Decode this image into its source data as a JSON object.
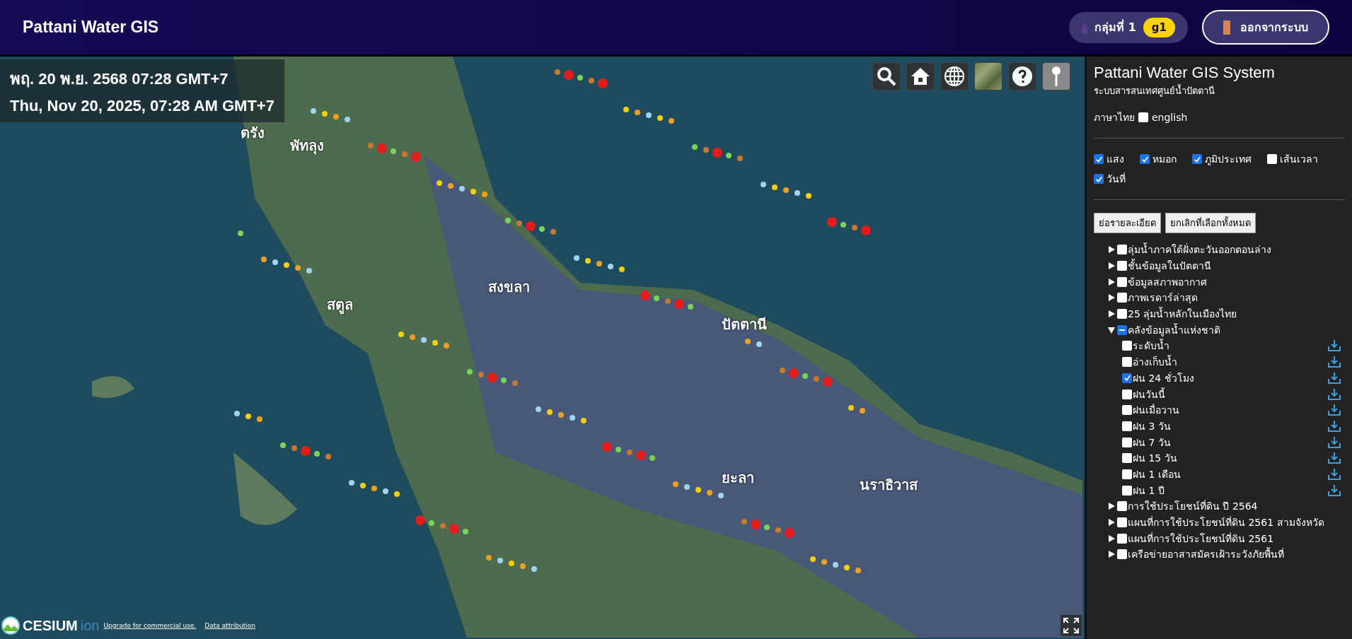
{
  "header": {
    "title": "Pattani Water GIS",
    "group_label": "กลุ่มที่ 1",
    "group_badge": "g1",
    "logout": "ออกจากระบบ"
  },
  "map": {
    "datetime_th": "พฤ. 20 พ.ย. 2568 07:28 GMT+7",
    "datetime_en": "Thu, Nov 20, 2025, 07:28 AM GMT+7",
    "place_labels": [
      {
        "text": "ตรัง"
      },
      {
        "text": "พัทลุง"
      },
      {
        "text": "สงขลา"
      },
      {
        "text": "สตูล"
      },
      {
        "text": "ปัตตานี"
      },
      {
        "text": "ยะลา"
      },
      {
        "text": "นราธิวาส"
      }
    ],
    "attribution": {
      "logo": "CESIUM",
      "logo_suffix": "ion",
      "links": [
        "Upgrade for commercial use.",
        "Data attribution"
      ]
    }
  },
  "sidebar": {
    "title": "Pattani Water GIS System",
    "subtitle": "ระบบสารสนเทศศูนย์น้ำปัตตานี",
    "language": {
      "label": "ภาษาไทย",
      "option": "english",
      "checked": false
    },
    "display_options": [
      {
        "label": "แสง",
        "checked": true
      },
      {
        "label": "หมอก",
        "checked": true
      },
      {
        "label": "ภูมิประเทศ",
        "checked": true
      },
      {
        "label": "เส้นเวลา",
        "checked": false
      },
      {
        "label": "วันที่",
        "checked": true
      }
    ],
    "buttons": [
      "ย่อรายละเอียด",
      "ยกเลิกที่เลือกทั้งหมด"
    ],
    "layers": [
      {
        "label": "ลุ่มน้ำภาคใต้ฝั่งตะวันออกตอนล่าง",
        "checked": false,
        "indeterminate": false,
        "expanded": false
      },
      {
        "label": "ชั้นข้อมูลในปัตตานี",
        "checked": false,
        "indeterminate": false,
        "expanded": false
      },
      {
        "label": "ข้อมูลสภาพอากาศ",
        "checked": false,
        "indeterminate": false,
        "expanded": false
      },
      {
        "label": "ภาพเรดาร์ล่าสุด",
        "checked": false,
        "indeterminate": false,
        "expanded": false
      },
      {
        "label": "25 ลุ่มน้ำหลักในเมืองไทย",
        "checked": false,
        "indeterminate": false,
        "expanded": false
      },
      {
        "label": "คลังข้อมูลน้ำแห่งชาติ",
        "checked": false,
        "indeterminate": true,
        "expanded": true,
        "children": [
          {
            "label": "ระดับน้ำ",
            "checked": false
          },
          {
            "label": "อ่างเก็บน้ำ",
            "checked": false
          },
          {
            "label": "ฝน 24 ชั่วโมง",
            "checked": true
          },
          {
            "label": "ฝนวันนี้",
            "checked": false
          },
          {
            "label": "ฝนเมื่อวาน",
            "checked": false
          },
          {
            "label": "ฝน 3 วัน",
            "checked": false
          },
          {
            "label": "ฝน 7 วัน",
            "checked": false
          },
          {
            "label": "ฝน 15 วัน",
            "checked": false
          },
          {
            "label": "ฝน 1 เดือน",
            "checked": false
          },
          {
            "label": "ฝน 1 ปี",
            "checked": false
          }
        ]
      },
      {
        "label": "การใช้ประโยชน์ที่ดิน ปี 2564",
        "checked": false,
        "indeterminate": false,
        "expanded": false
      },
      {
        "label": "แผนที่การใช้ประโยชน์ที่ดิน 2561 สามจังหวัด",
        "checked": false,
        "indeterminate": false,
        "expanded": false
      },
      {
        "label": "แผนที่การใช้ประโยชน์ที่ดิน 2561",
        "checked": false,
        "indeterminate": false,
        "expanded": false
      },
      {
        "label": "เครือข่ายอาสาสมัครเฝ้าระวังภัยพื้นที่",
        "checked": false,
        "indeterminate": false,
        "expanded": false
      }
    ]
  }
}
